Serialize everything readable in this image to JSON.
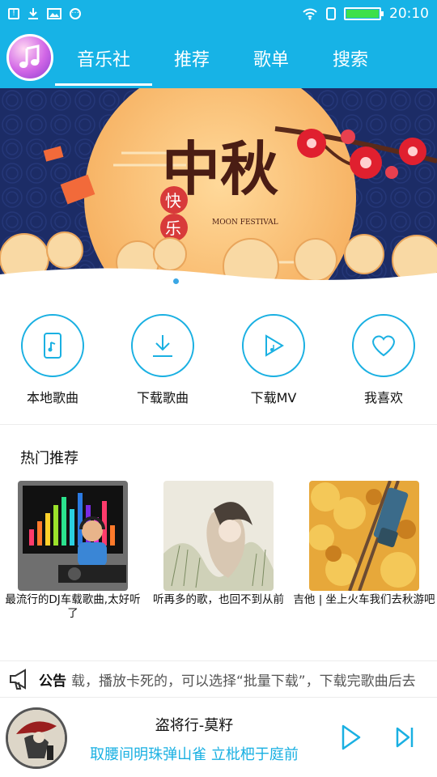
{
  "status_bar": {
    "time": "20:10"
  },
  "header": {
    "tabs": [
      {
        "label": "音乐社",
        "active": true
      },
      {
        "label": "推荐",
        "active": false
      },
      {
        "label": "歌单",
        "active": false
      },
      {
        "label": "搜索",
        "active": false
      }
    ]
  },
  "banner": {
    "title": "中秋",
    "subtitle_1": "快",
    "subtitle_2": "乐",
    "english": "MOON FESTIVAL"
  },
  "quick_actions": [
    {
      "label": "本地歌曲",
      "icon": "phone-music-icon"
    },
    {
      "label": "下载歌曲",
      "icon": "download-icon"
    },
    {
      "label": "下载MV",
      "icon": "video-music-icon"
    },
    {
      "label": "我喜欢",
      "icon": "heart-icon"
    }
  ],
  "hot": {
    "title": "热门推荐",
    "items": [
      {
        "caption": "最流行的DJ车载歌曲,太好听了"
      },
      {
        "caption": "听再多的歌，也回不到从前"
      },
      {
        "caption": "吉他 | 坐上火车我们去秋游吧"
      }
    ]
  },
  "notice": {
    "label": "公告",
    "text": "载，播放卡死的，可以选择“批量下载”，下载完歌曲后去"
  },
  "player": {
    "song": "盗将行-莫籽",
    "lyric": "取腰间明珠弹山雀 立枇杷于庭前"
  },
  "colors": {
    "accent": "#17b3e6",
    "lyric": "#1ab0e2"
  }
}
